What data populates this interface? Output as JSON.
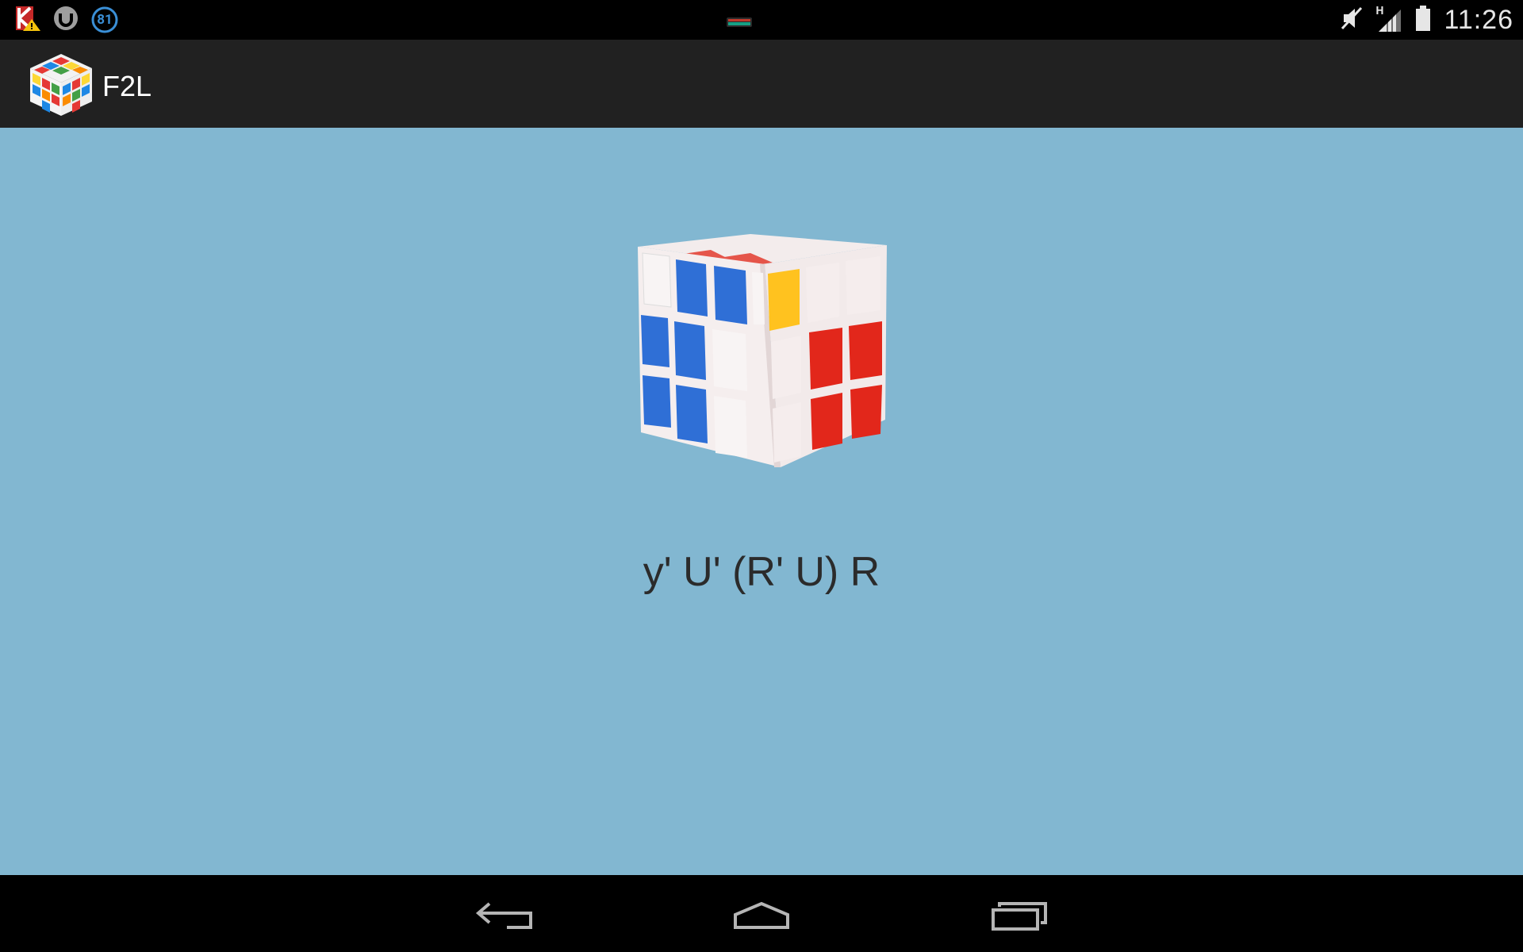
{
  "status_bar": {
    "time": "11:26",
    "notification_badge": "81",
    "network_type": "H",
    "icons": [
      "kaspersky-warning-icon",
      "utorrent-icon",
      "notification-count-icon",
      "media-thumbnail-icon",
      "mute-icon",
      "signal-icon",
      "battery-icon"
    ]
  },
  "action_bar": {
    "title": "F2L",
    "icon": "rubiks-cube-app-icon"
  },
  "main": {
    "cube_image": "rubiks-cube-image",
    "algorithm": "y' U' (R' U) R",
    "colors": {
      "blue": "#2f6fd6",
      "red": "#e2271b",
      "yellow": "#ffc21f",
      "white": "#f5eeee",
      "orange_red": "#e5554a"
    }
  },
  "nav_bar": {
    "buttons": [
      "back-icon",
      "home-icon",
      "recents-icon"
    ]
  }
}
